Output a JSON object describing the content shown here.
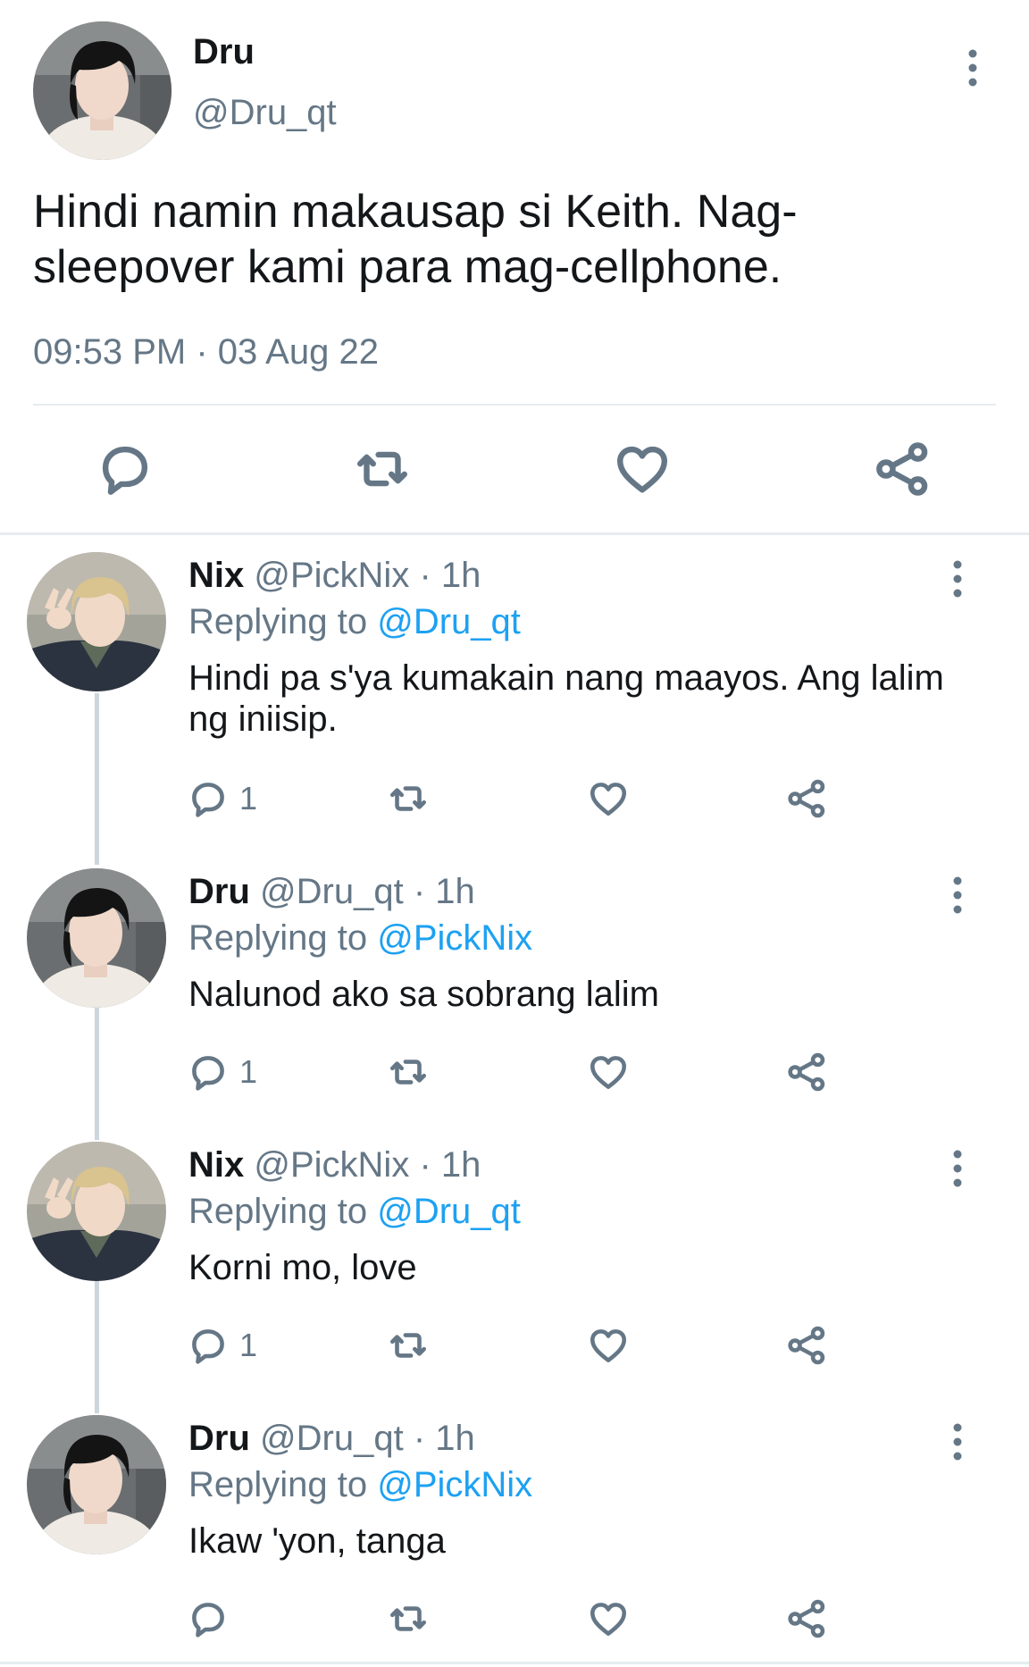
{
  "main_tweet": {
    "name": "Dru",
    "handle": "@Dru_qt",
    "text": "Hindi namin makausap si Keith. Nag-sleepover kami para mag-cellphone.",
    "timestamp": "09:53 PM · 03 Aug 22",
    "actions": [
      "reply-icon",
      "retweet-icon",
      "like-icon",
      "share-icon"
    ]
  },
  "replies": [
    {
      "name": "Nix",
      "handle": "@PickNix",
      "time": " · 1h",
      "replying_label": "Replying to ",
      "replying_to": "@Dru_qt",
      "text": "Hindi pa s'ya kumakain nang maayos. Ang lalim ng iniisip.",
      "reply_count": "1"
    },
    {
      "name": "Dru",
      "handle": "@Dru_qt",
      "time": " · 1h",
      "replying_label": "Replying to ",
      "replying_to": "@PickNix",
      "text": "Nalunod ako sa sobrang lalim",
      "reply_count": "1"
    },
    {
      "name": "Nix",
      "handle": "@PickNix",
      "time": " · 1h",
      "replying_label": "Replying to ",
      "replying_to": "@Dru_qt",
      "text": "Korni mo, love",
      "reply_count": "1"
    },
    {
      "name": "Dru",
      "handle": "@Dru_qt",
      "time": " · 1h",
      "replying_label": "Replying to ",
      "replying_to": "@PickNix",
      "text": "Ikaw 'yon, tanga",
      "reply_count": ""
    }
  ],
  "colors": {
    "mention": "#1da1f2",
    "secondary_text": "#657786",
    "divider": "#e6ecf0"
  }
}
